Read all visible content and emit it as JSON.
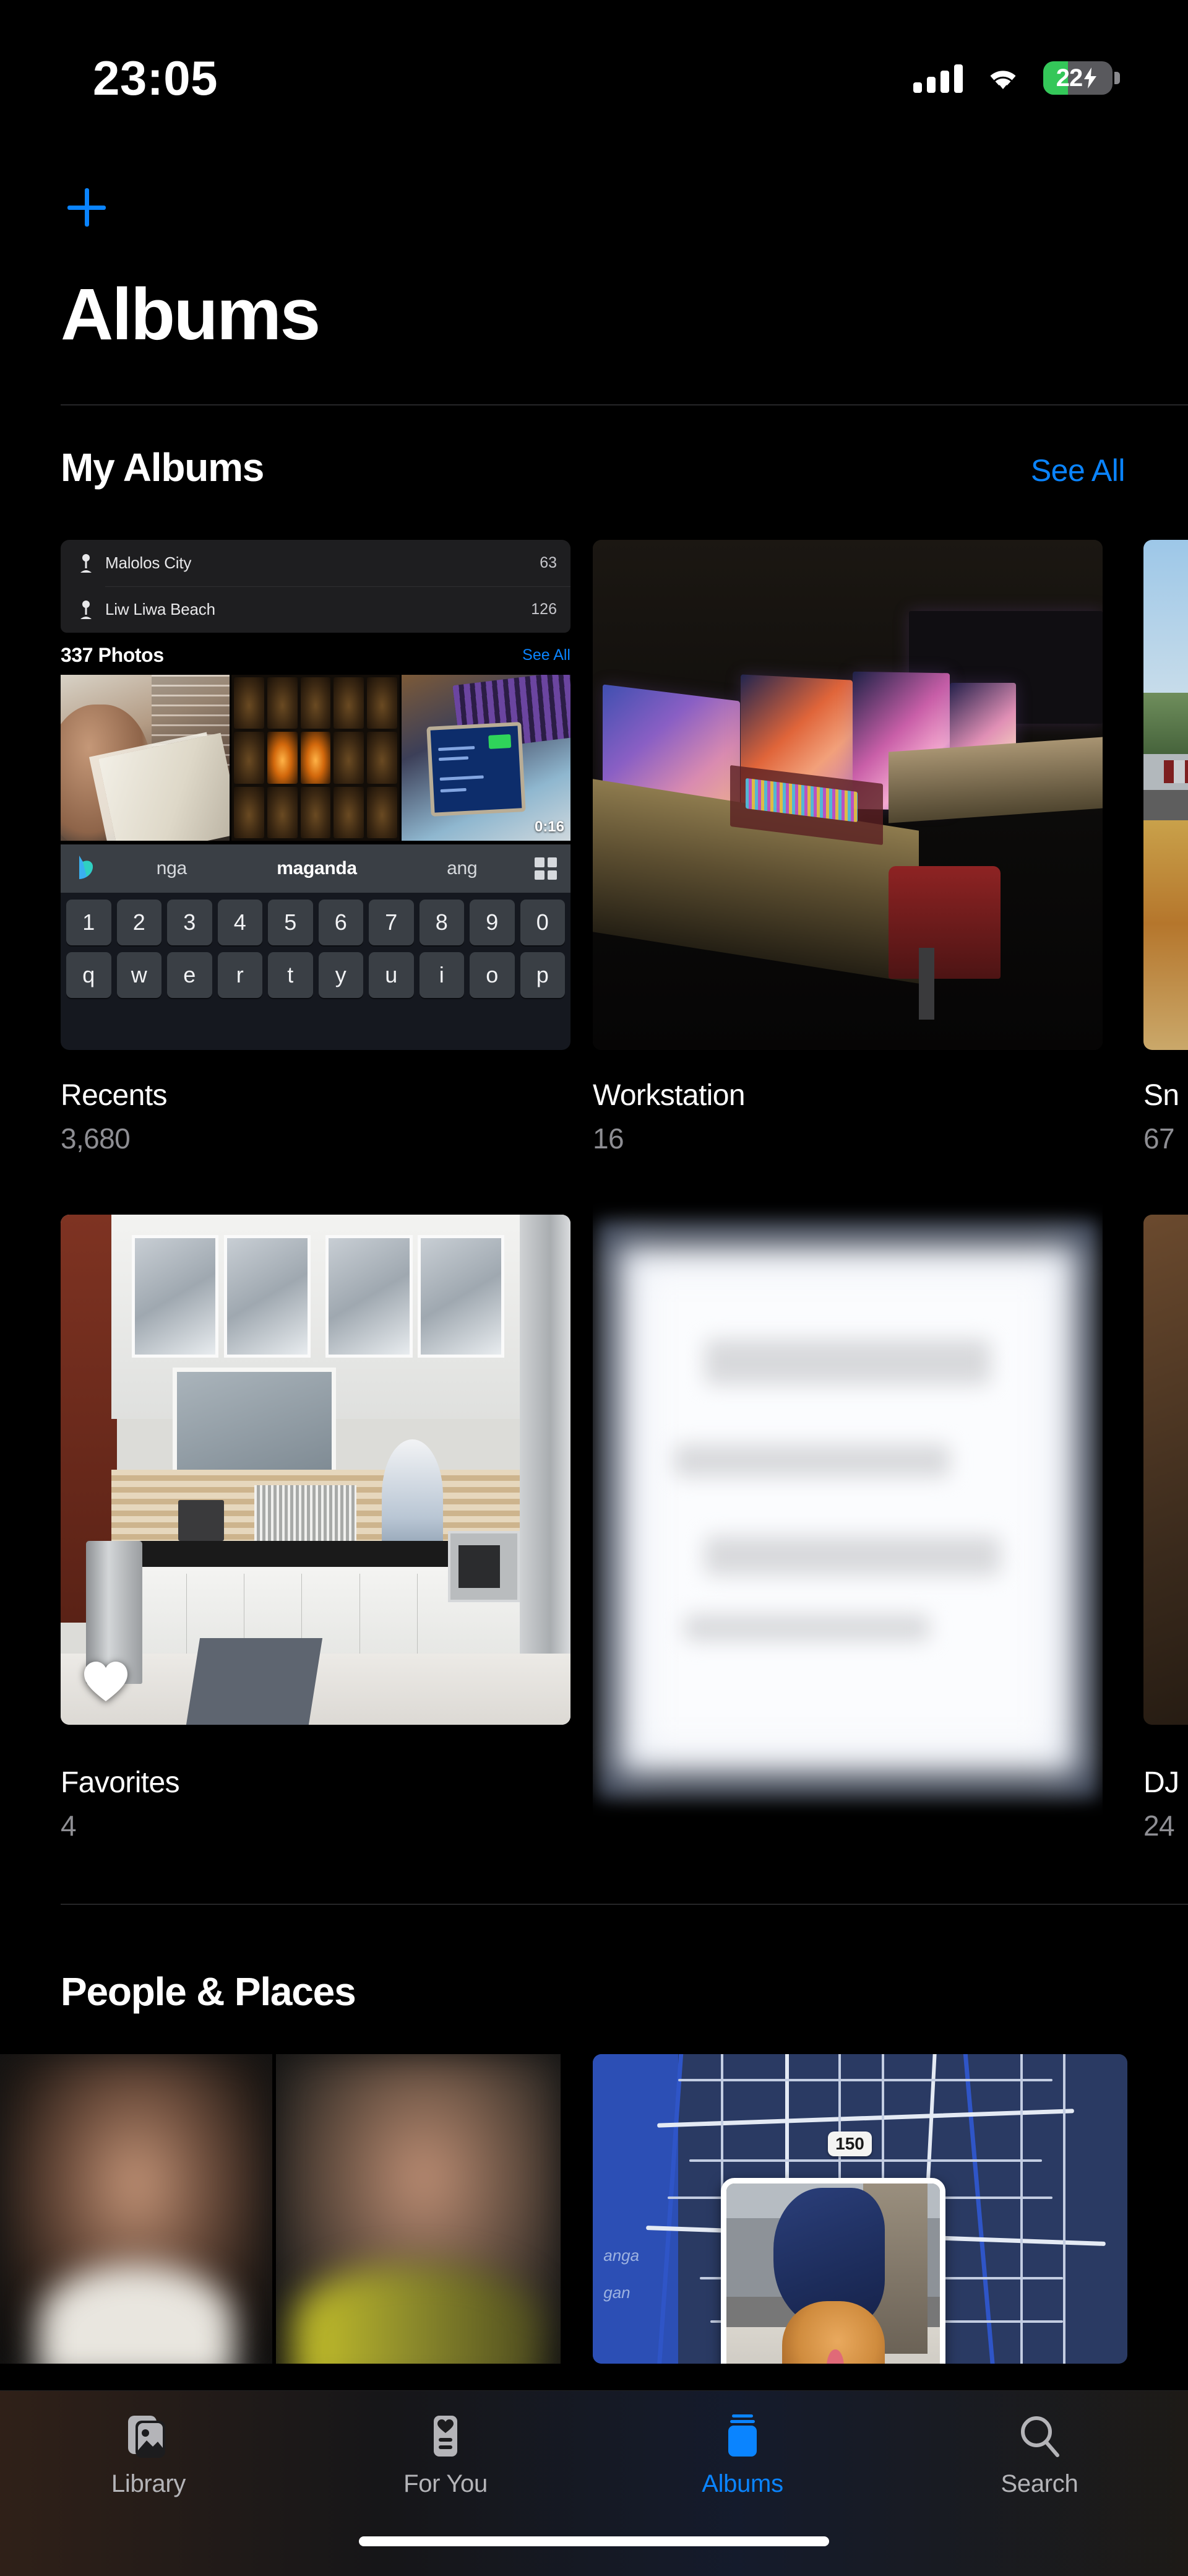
{
  "status_bar": {
    "time": "23:05",
    "battery_level": "22",
    "battery_charging": true,
    "signal_bars": 4,
    "wifi": true
  },
  "nav": {
    "add_label": "+"
  },
  "header": {
    "title": "Albums"
  },
  "sections": [
    {
      "id": "my-albums",
      "title": "My Albums",
      "see_all_label": "See All"
    },
    {
      "id": "people-places",
      "title": "People & Places"
    }
  ],
  "albums": [
    {
      "id": "recents",
      "name": "Recents",
      "count": "3,680"
    },
    {
      "id": "workstation",
      "name": "Workstation",
      "count": "16"
    },
    {
      "id": "snaps",
      "name": "Sn",
      "count": "67"
    },
    {
      "id": "favorites",
      "name": "Favorites",
      "count": "4"
    },
    {
      "id": "untitled",
      "name": "",
      "count": ""
    },
    {
      "id": "dj",
      "name": "DJ",
      "count": "24"
    }
  ],
  "recents_thumbnail": {
    "places_list": [
      {
        "name": "Malolos City",
        "count": "63"
      },
      {
        "name": "Liw Liwa Beach",
        "count": "126"
      }
    ],
    "photos_bar": {
      "title": "337 Photos",
      "see_all_label": "See All"
    },
    "video_duration": "0:16",
    "keyboard": {
      "suggestions": [
        "nga",
        "maganda",
        "ang"
      ],
      "active_suggestion": "maganda",
      "number_row": [
        "1",
        "2",
        "3",
        "4",
        "5",
        "6",
        "7",
        "8",
        "9",
        "0"
      ],
      "letter_row": [
        "q",
        "w",
        "e",
        "r",
        "t",
        "y",
        "u",
        "i",
        "o",
        "p"
      ]
    }
  },
  "places_map": {
    "highway_shield": "150",
    "labels": [
      "anga",
      "gan"
    ]
  },
  "tabbar": {
    "items": [
      {
        "id": "library",
        "label": "Library",
        "icon": "photo-stack-icon",
        "active": false
      },
      {
        "id": "for-you",
        "label": "For You",
        "icon": "heart-card-icon",
        "active": false
      },
      {
        "id": "albums",
        "label": "Albums",
        "icon": "albums-book-icon",
        "active": true
      },
      {
        "id": "search",
        "label": "Search",
        "icon": "magnifier-icon",
        "active": false
      }
    ]
  },
  "colors": {
    "accent": "#0a84ff",
    "background": "#000000",
    "secondary_text": "#8e8e93",
    "battery_green": "#34c759"
  }
}
